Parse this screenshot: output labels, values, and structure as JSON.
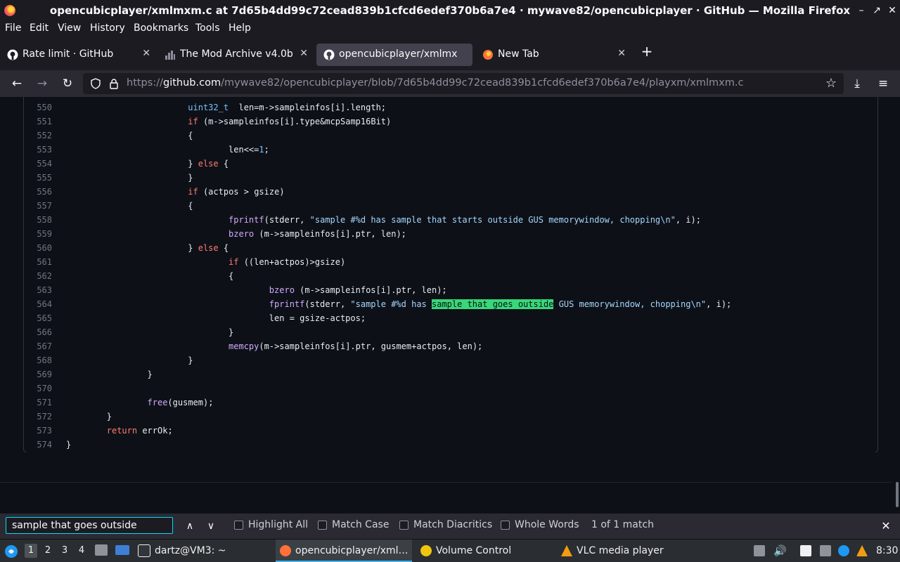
{
  "window": {
    "title": "opencubicplayer/xmlmxm.c at 7d65b4dd99c72cead839b1cfcd6edef370b6a7e4 · mywave82/opencubicplayer · GitHub — Mozilla Firefox",
    "controls": [
      "–",
      "↗",
      "✕"
    ]
  },
  "menu": [
    "File",
    "Edit",
    "View",
    "History",
    "Bookmarks",
    "Tools",
    "Help"
  ],
  "tabs": [
    {
      "label": "Rate limit · GitHub",
      "icon": "github-icon",
      "close": "✕"
    },
    {
      "label": "The Mod Archive v4.0b - ",
      "icon": "modarchive-icon",
      "close": "✕"
    },
    {
      "label": "opencubicplayer/xmlmxm",
      "icon": "github-icon",
      "close": "✕"
    },
    {
      "label": "New Tab",
      "icon": "firefox-icon",
      "close": "✕"
    }
  ],
  "new_tab": "+",
  "nav": {
    "back": "←",
    "forward": "→",
    "reload": "↻",
    "url_prefix": "https://",
    "url_host": "github.com",
    "url_path": "/mywave82/opencubicplayer/blob/7d65b4dd99c72cead839b1cfcd6edef370b6a7e4/playxm/xmlmxm.c",
    "bookmark": "☆",
    "downloads": "⤓",
    "menu": "≡"
  },
  "code": {
    "line_numbers": [
      "550",
      "551",
      "552",
      "553",
      "554",
      "555",
      "556",
      "557",
      "558",
      "559",
      "560",
      "561",
      "562",
      "563",
      "564",
      "565",
      "566",
      "567",
      "568",
      "569",
      "570",
      "571",
      "572",
      "573",
      "574"
    ],
    "lines": [
      {
        "indent": 6,
        "parts": [
          [
            "ty",
            "uint32_t"
          ],
          [
            "",
            "  len=m->sampleinfos[i].length;"
          ]
        ]
      },
      {
        "indent": 6,
        "parts": [
          [
            "kw",
            "if"
          ],
          [
            "",
            " (m->sampleinfos[i].type&mcpSamp16Bit)"
          ]
        ]
      },
      {
        "indent": 6,
        "parts": [
          [
            "",
            "{"
          ]
        ]
      },
      {
        "indent": 8,
        "parts": [
          [
            "",
            "len<<="
          ],
          [
            "num",
            "1"
          ],
          [
            "",
            ";"
          ]
        ]
      },
      {
        "indent": 6,
        "parts": [
          [
            "",
            "} "
          ],
          [
            "kw",
            "else"
          ],
          [
            "",
            " {"
          ]
        ]
      },
      {
        "indent": 6,
        "parts": [
          [
            "",
            "}"
          ]
        ]
      },
      {
        "indent": 6,
        "parts": [
          [
            "kw",
            "if"
          ],
          [
            "",
            " (actpos > gsize)"
          ]
        ]
      },
      {
        "indent": 6,
        "parts": [
          [
            "",
            "{"
          ]
        ]
      },
      {
        "indent": 8,
        "parts": [
          [
            "fn",
            "fprintf"
          ],
          [
            "",
            "(stderr, "
          ],
          [
            "str",
            "\"sample #%d has sample that starts outside GUS memorywindow, chopping\\n\""
          ],
          [
            "",
            ", i);"
          ]
        ]
      },
      {
        "indent": 8,
        "parts": [
          [
            "fn",
            "bzero"
          ],
          [
            "",
            " (m->sampleinfos[i].ptr, len);"
          ]
        ]
      },
      {
        "indent": 6,
        "parts": [
          [
            "",
            "} "
          ],
          [
            "kw",
            "else"
          ],
          [
            "",
            " {"
          ]
        ]
      },
      {
        "indent": 8,
        "parts": [
          [
            "kw",
            "if"
          ],
          [
            "",
            " ((len+actpos)>gsize)"
          ]
        ]
      },
      {
        "indent": 8,
        "parts": [
          [
            "",
            "{"
          ]
        ]
      },
      {
        "indent": 10,
        "parts": [
          [
            "fn",
            "bzero"
          ],
          [
            "",
            " (m->sampleinfos[i].ptr, len);"
          ]
        ]
      },
      {
        "indent": 10,
        "parts": [
          [
            "fn",
            "fprintf"
          ],
          [
            "",
            "(stderr, "
          ],
          [
            "str",
            "\"sample #%d has "
          ],
          [
            "hl",
            "sample that goes outside"
          ],
          [
            "str",
            " GUS memorywindow, chopping\\n\""
          ],
          [
            "",
            ", i);"
          ]
        ]
      },
      {
        "indent": 10,
        "parts": [
          [
            "",
            "len = gsize-actpos;"
          ]
        ]
      },
      {
        "indent": 8,
        "parts": [
          [
            "",
            "}"
          ]
        ]
      },
      {
        "indent": 8,
        "parts": [
          [
            "fn",
            "memcpy"
          ],
          [
            "",
            "(m->sampleinfos[i].ptr, gusmem+actpos, len);"
          ]
        ]
      },
      {
        "indent": 6,
        "parts": [
          [
            "",
            "}"
          ]
        ]
      },
      {
        "indent": 4,
        "parts": [
          [
            "",
            "}"
          ]
        ]
      },
      {
        "indent": 0,
        "parts": [
          [
            "",
            ""
          ]
        ]
      },
      {
        "indent": 4,
        "parts": [
          [
            "fn",
            "free"
          ],
          [
            "",
            "(gusmem);"
          ]
        ]
      },
      {
        "indent": 2,
        "parts": [
          [
            "",
            "}"
          ]
        ]
      },
      {
        "indent": 2,
        "parts": [
          [
            "kw",
            "return"
          ],
          [
            "",
            " errOk;"
          ]
        ]
      },
      {
        "indent": 0,
        "parts": [
          [
            "",
            "}"
          ]
        ]
      }
    ]
  },
  "findbar": {
    "query": "sample that goes outside",
    "prev": "∧",
    "next": "∨",
    "highlight_all": "Highlight All",
    "match_case": "Match Case",
    "match_diacritics": "Match Diacritics",
    "whole_words": "Whole Words",
    "result": "1 of 1 match",
    "close": "✕"
  },
  "taskbar": {
    "workspaces": [
      "1",
      "2",
      "3",
      "4"
    ],
    "active_workspace": "1",
    "tasks": [
      {
        "label": "dartz@VM3: ~",
        "icon": "terminal-icon"
      },
      {
        "label": "opencubicplayer/xml…",
        "icon": "firefox-icon"
      },
      {
        "label": "Volume Control",
        "icon": "volume-control-icon"
      },
      {
        "label": "VLC media player",
        "icon": "vlc-icon"
      }
    ],
    "clock": "8:30"
  },
  "colors": {
    "page_bg": "#0d1117",
    "find_highlight": "#38d878",
    "accent": "#00ddff"
  }
}
